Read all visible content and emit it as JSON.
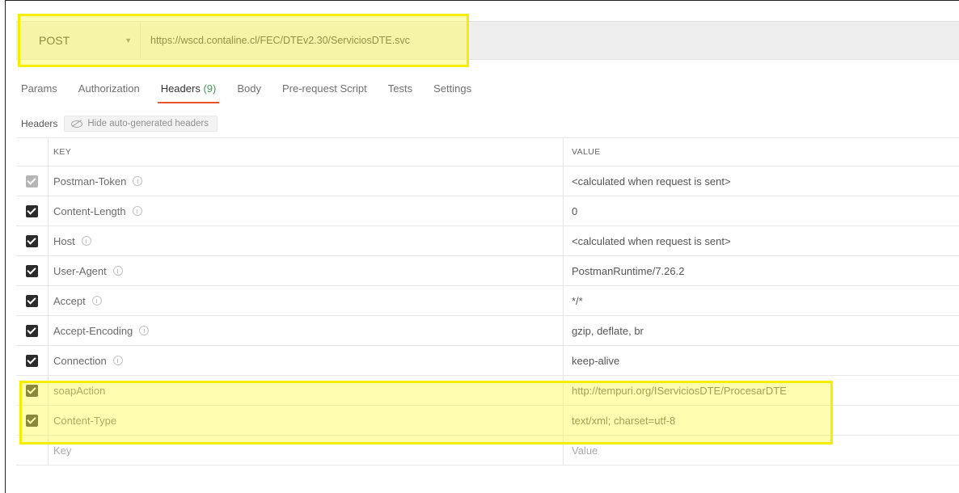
{
  "request": {
    "method": "POST",
    "url": "https://wscd.contaline.cl/FEC/DTEv2.30/ServiciosDTE.svc"
  },
  "tabs": [
    {
      "label": "Params"
    },
    {
      "label": "Authorization"
    },
    {
      "label": "Headers",
      "count": "(9)"
    },
    {
      "label": "Body"
    },
    {
      "label": "Pre-request Script"
    },
    {
      "label": "Tests"
    },
    {
      "label": "Settings"
    }
  ],
  "headers_section": {
    "title": "Headers",
    "toggle_label": "Hide auto-generated headers"
  },
  "table": {
    "columns": {
      "key": "KEY",
      "value": "VALUE"
    },
    "rows": [
      {
        "key": "Postman-Token",
        "value": "<calculated when request is sent>"
      },
      {
        "key": "Content-Length",
        "value": "0"
      },
      {
        "key": "Host",
        "value": "<calculated when request is sent>"
      },
      {
        "key": "User-Agent",
        "value": "PostmanRuntime/7.26.2"
      },
      {
        "key": "Accept",
        "value": "*/*"
      },
      {
        "key": "Accept-Encoding",
        "value": "gzip, deflate, br"
      },
      {
        "key": "Connection",
        "value": "keep-alive"
      },
      {
        "key": "soapAction",
        "value": "http://tempuri.org/IServiciosDTE/ProcesarDTE"
      },
      {
        "key": "Content-Type",
        "value": "text/xml; charset=utf-8"
      }
    ],
    "new_row": {
      "key_placeholder": "Key",
      "value_placeholder": "Value"
    }
  },
  "colors": {
    "highlight": "#fff75a",
    "active_tab_underline": "#e8542f",
    "count": "#3fa34d"
  },
  "icons": {
    "method_dropdown": "caret-down-icon",
    "auto_headers_toggle": "eye-slash-icon",
    "row_info": "info-icon",
    "row_check": "checkbox-checked-icon"
  }
}
